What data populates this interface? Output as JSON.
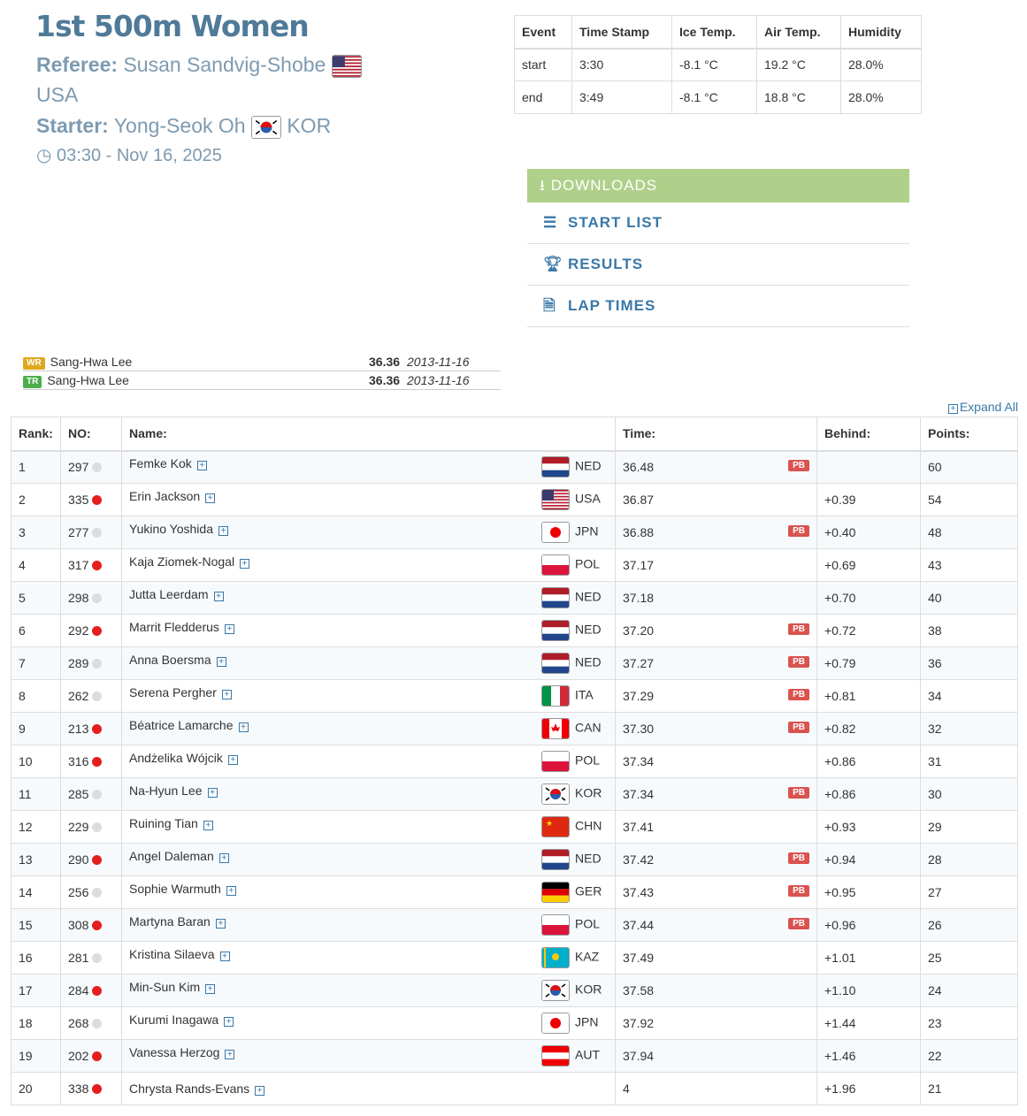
{
  "header": {
    "title": "1st 500m Women",
    "referee_label": "Referee:",
    "referee": "Susan Sandvig-Shobe",
    "referee_country": "USA",
    "starter_label": "Starter:",
    "starter": "Yong-Seok Oh",
    "starter_country": "KOR",
    "datetime": "03:30 - Nov 16, 2025"
  },
  "conditions": {
    "headers": [
      "Event",
      "Time Stamp",
      "Ice Temp.",
      "Air Temp.",
      "Humidity"
    ],
    "rows": [
      [
        "start",
        "3:30",
        "-8.1 °C",
        "19.2 °C",
        "28.0%"
      ],
      [
        "end",
        "3:49",
        "-8.1 °C",
        "18.8 °C",
        "28.0%"
      ]
    ]
  },
  "downloads": {
    "title": "DOWNLOADS",
    "items": [
      {
        "label": "START LIST",
        "icon": "list-icon"
      },
      {
        "label": "RESULTS",
        "icon": "trophy-icon"
      },
      {
        "label": "LAP TIMES",
        "icon": "document-icon"
      }
    ]
  },
  "records": [
    {
      "type": "WR",
      "name": "Sang-Hwa Lee",
      "time": "36.36",
      "date": "2013-11-16",
      "color": "#e0a81e"
    },
    {
      "type": "TR",
      "name": "Sang-Hwa Lee",
      "time": "36.36",
      "date": "2013-11-16",
      "color": "#4cae4c"
    }
  ],
  "expand_all": "Expand All",
  "table": {
    "headers": [
      "Rank:",
      "NO:",
      "Name:",
      "Time:",
      "Behind:",
      "Points:"
    ],
    "pb_label": "PB",
    "rows": [
      {
        "rank": "1",
        "no": "297",
        "dot": "gray",
        "name": "Femke Kok",
        "country": "NED",
        "time": "36.48",
        "pb": true,
        "behind": "",
        "points": "60"
      },
      {
        "rank": "2",
        "no": "335",
        "dot": "red",
        "name": "Erin Jackson",
        "country": "USA",
        "time": "36.87",
        "pb": false,
        "behind": "+0.39",
        "points": "54"
      },
      {
        "rank": "3",
        "no": "277",
        "dot": "gray",
        "name": "Yukino Yoshida",
        "country": "JPN",
        "time": "36.88",
        "pb": true,
        "behind": "+0.40",
        "points": "48"
      },
      {
        "rank": "4",
        "no": "317",
        "dot": "red",
        "name": "Kaja Ziomek-Nogal",
        "country": "POL",
        "time": "37.17",
        "pb": false,
        "behind": "+0.69",
        "points": "43"
      },
      {
        "rank": "5",
        "no": "298",
        "dot": "gray",
        "name": "Jutta Leerdam",
        "country": "NED",
        "time": "37.18",
        "pb": false,
        "behind": "+0.70",
        "points": "40"
      },
      {
        "rank": "6",
        "no": "292",
        "dot": "red",
        "name": "Marrit Fledderus",
        "country": "NED",
        "time": "37.20",
        "pb": true,
        "behind": "+0.72",
        "points": "38"
      },
      {
        "rank": "7",
        "no": "289",
        "dot": "gray",
        "name": "Anna Boersma",
        "country": "NED",
        "time": "37.27",
        "pb": true,
        "behind": "+0.79",
        "points": "36"
      },
      {
        "rank": "8",
        "no": "262",
        "dot": "gray",
        "name": "Serena Pergher",
        "country": "ITA",
        "time": "37.29",
        "pb": true,
        "behind": "+0.81",
        "points": "34"
      },
      {
        "rank": "9",
        "no": "213",
        "dot": "red",
        "name": "Béatrice Lamarche",
        "country": "CAN",
        "time": "37.30",
        "pb": true,
        "behind": "+0.82",
        "points": "32"
      },
      {
        "rank": "10",
        "no": "316",
        "dot": "red",
        "name": "Andżelika Wójcik",
        "country": "POL",
        "time": "37.34",
        "pb": false,
        "behind": "+0.86",
        "points": "31"
      },
      {
        "rank": "11",
        "no": "285",
        "dot": "gray",
        "name": "Na-Hyun Lee",
        "country": "KOR",
        "time": "37.34",
        "pb": true,
        "behind": "+0.86",
        "points": "30"
      },
      {
        "rank": "12",
        "no": "229",
        "dot": "gray",
        "name": "Ruining Tian",
        "country": "CHN",
        "time": "37.41",
        "pb": false,
        "behind": "+0.93",
        "points": "29"
      },
      {
        "rank": "13",
        "no": "290",
        "dot": "red",
        "name": "Angel Daleman",
        "country": "NED",
        "time": "37.42",
        "pb": true,
        "behind": "+0.94",
        "points": "28"
      },
      {
        "rank": "14",
        "no": "256",
        "dot": "gray",
        "name": "Sophie Warmuth",
        "country": "GER",
        "time": "37.43",
        "pb": true,
        "behind": "+0.95",
        "points": "27"
      },
      {
        "rank": "15",
        "no": "308",
        "dot": "red",
        "name": "Martyna Baran",
        "country": "POL",
        "time": "37.44",
        "pb": true,
        "behind": "+0.96",
        "points": "26"
      },
      {
        "rank": "16",
        "no": "281",
        "dot": "gray",
        "name": "Kristina Silaeva",
        "country": "KAZ",
        "time": "37.49",
        "pb": false,
        "behind": "+1.01",
        "points": "25"
      },
      {
        "rank": "17",
        "no": "284",
        "dot": "red",
        "name": "Min-Sun Kim",
        "country": "KOR",
        "time": "37.58",
        "pb": false,
        "behind": "+1.10",
        "points": "24"
      },
      {
        "rank": "18",
        "no": "268",
        "dot": "gray",
        "name": "Kurumi Inagawa",
        "country": "JPN",
        "time": "37.92",
        "pb": false,
        "behind": "+1.44",
        "points": "23"
      },
      {
        "rank": "19",
        "no": "202",
        "dot": "red",
        "name": "Vanessa Herzog",
        "country": "AUT",
        "time": "37.94",
        "pb": false,
        "behind": "+1.46",
        "points": "22"
      },
      {
        "rank": "20",
        "no": "338",
        "dot": "red",
        "name": "Chrysta Rands-Evans",
        "country": "",
        "time": "4",
        "pb": false,
        "behind": "+1.96",
        "points": "21"
      }
    ]
  },
  "colors": {
    "red": "#e41e1e",
    "gray": "#dddddd",
    "link": "#3a78a8"
  }
}
